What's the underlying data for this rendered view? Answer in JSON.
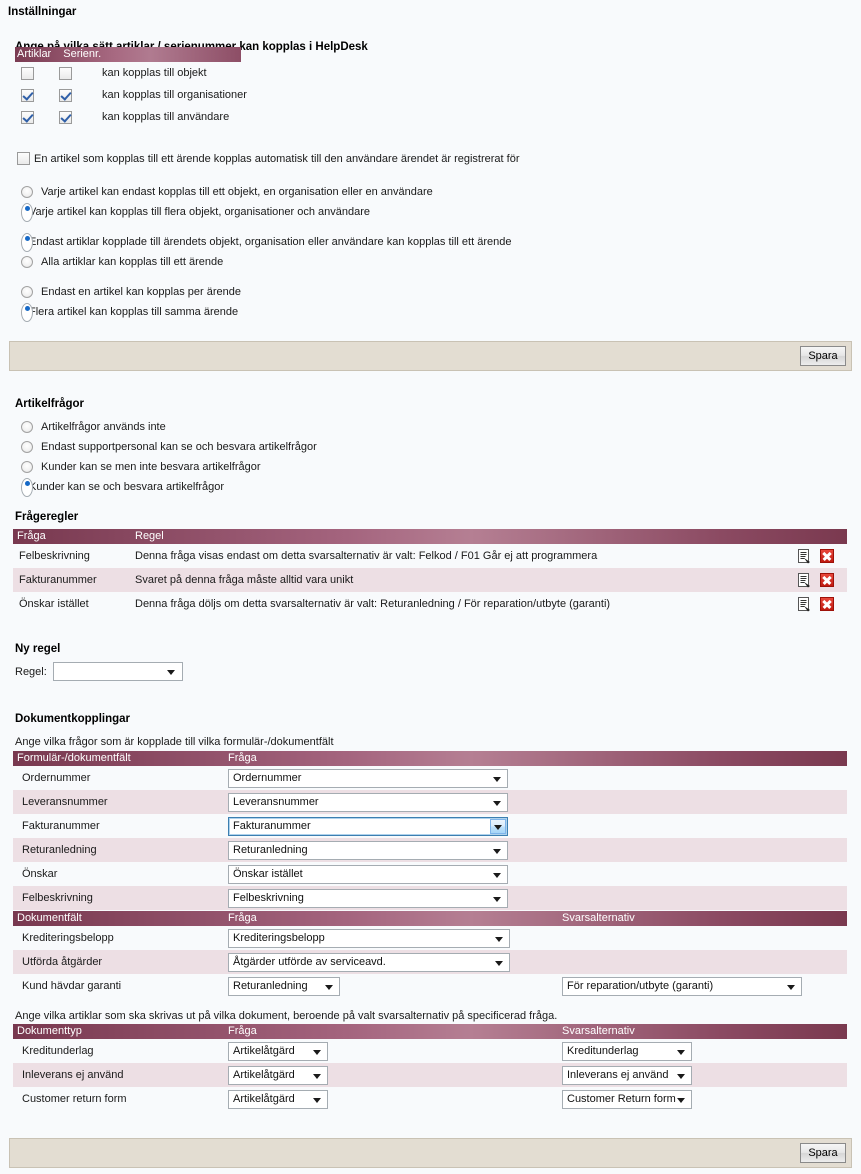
{
  "app": {
    "title": "Inställningar"
  },
  "linking": {
    "heading": "Ange på vilka sätt artiklar / serienummer kan kopplas i HelpDesk",
    "col_articles": "Artiklar",
    "col_serial": "Serienr.",
    "rows": [
      {
        "label": "kan kopplas till objekt",
        "articles": false,
        "serial": false
      },
      {
        "label": "kan kopplas till organisationer",
        "articles": true,
        "serial": true
      },
      {
        "label": "kan kopplas till användare",
        "articles": true,
        "serial": true
      }
    ],
    "auto_link_checkbox": {
      "label": "En artikel som kopplas till ett ärende kopplas automatisk till den användare ärendet är registrerat för",
      "checked": false
    },
    "group_scope": [
      {
        "label": "Varje artikel kan endast kopplas till ett objekt, en organisation eller en användare",
        "selected": false
      },
      {
        "label": "Varje artikel kan kopplas till flera objekt, organisationer och användare",
        "selected": true
      }
    ],
    "group_availability": [
      {
        "label": "Endast artiklar kopplade till ärendets objekt, organisation eller användare kan kopplas till ett ärende",
        "selected": true
      },
      {
        "label": "Alla artiklar kan kopplas till ett ärende",
        "selected": false
      }
    ],
    "group_count": [
      {
        "label": "Endast en artikel kan kopplas per ärende",
        "selected": false
      },
      {
        "label": "Flera artikel kan kopplas till samma ärende",
        "selected": true
      }
    ]
  },
  "save_top": {
    "label": "Spara"
  },
  "save_bottom": {
    "label": "Spara"
  },
  "article_questions": {
    "heading": "Artikelfrågor",
    "options": [
      {
        "label": "Artikelfrågor används inte",
        "selected": false
      },
      {
        "label": "Endast supportpersonal kan se och besvara artikelfrågor",
        "selected": false
      },
      {
        "label": "Kunder kan se men inte besvara artikelfrågor",
        "selected": false
      },
      {
        "label": "Kunder kan se och besvara artikelfrågor",
        "selected": true
      }
    ]
  },
  "question_rules": {
    "heading": "Frågeregler",
    "columns": {
      "question": "Fråga",
      "rule": "Regel"
    },
    "rows": [
      {
        "question": "Felbeskrivning",
        "rule": "Denna fråga visas endast om detta svarsalternativ är valt: Felkod / F01 Går ej att programmera"
      },
      {
        "question": "Fakturanummer",
        "rule": "Svaret på denna fråga måste alltid vara unikt"
      },
      {
        "question": "Önskar istället",
        "rule": "Denna fråga döljs om detta svarsalternativ är valt: Returanledning / För reparation/utbyte (garanti)"
      }
    ]
  },
  "new_rule": {
    "heading": "Ny regel",
    "label": "Regel:",
    "value": ""
  },
  "document_links": {
    "heading": "Dokumentkopplingar",
    "intro": "Ange vilka frågor som är kopplade till vilka formulär-/dokumentfält",
    "columns": {
      "field": "Formulär-/dokumentfält",
      "question": "Fråga"
    },
    "rows": [
      {
        "field": "Ordernummer",
        "question": "Ordernummer",
        "focused": false
      },
      {
        "field": "Leveransnummer",
        "question": "Leveransnummer",
        "focused": false
      },
      {
        "field": "Fakturanummer",
        "question": "Fakturanummer",
        "focused": true
      },
      {
        "field": "Returanledning",
        "question": "Returanledning",
        "focused": false
      },
      {
        "field": "Önskar",
        "question": "Önskar istället",
        "focused": false
      },
      {
        "field": "Felbeskrivning",
        "question": "Felbeskrivning",
        "focused": false
      }
    ]
  },
  "document_fields": {
    "columns": {
      "field": "Dokumentfält",
      "question": "Fråga",
      "answer": "Svarsalternativ"
    },
    "rows": [
      {
        "field": "Krediteringsbelopp",
        "question": "Krediteringsbelopp",
        "answer": ""
      },
      {
        "field": "Utförda åtgärder",
        "question": "Åtgärder utförde av serviceavd.",
        "answer": ""
      },
      {
        "field": "Kund hävdar garanti",
        "question": "Returanledning",
        "answer": "För reparation/utbyte (garanti)"
      }
    ]
  },
  "document_types": {
    "intro": "Ange vilka artiklar som ska skrivas ut på vilka dokument, beroende på valt svarsalternativ på specificerad fråga.",
    "columns": {
      "type": "Dokumenttyp",
      "question": "Fråga",
      "answer": "Svarsalternativ"
    },
    "rows": [
      {
        "type": "Kreditunderlag",
        "question": "Artikelåtgärd",
        "answer": "Kreditunderlag"
      },
      {
        "type": "Inleverans ej använd",
        "question": "Artikelåtgärd",
        "answer": "Inleverans ej använd"
      },
      {
        "type": "Customer return form",
        "question": "Artikelåtgärd",
        "answer": "Customer Return form"
      }
    ]
  }
}
